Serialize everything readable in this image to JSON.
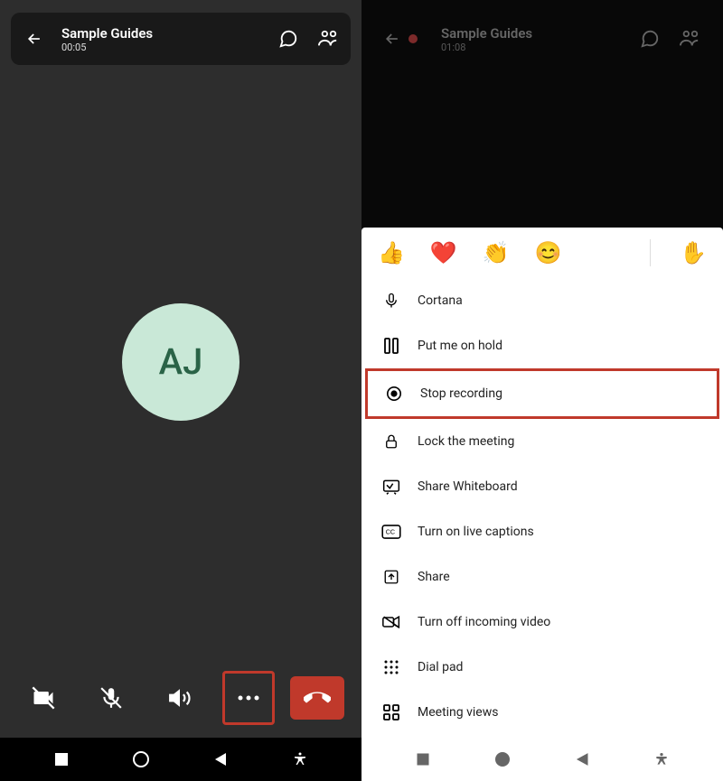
{
  "left": {
    "header": {
      "title": "Sample Guides",
      "duration": "00:05"
    },
    "avatar_initials": "AJ",
    "icons": {
      "back": "back-arrow",
      "chat": "chat-icon",
      "people": "people-icon",
      "camera_off": "camera-off-icon",
      "mic_off": "mic-off-icon",
      "speaker": "speaker-icon",
      "more": "more-icon",
      "hangup": "hangup-icon"
    }
  },
  "right": {
    "header": {
      "title": "Sample Guides",
      "duration": "01:08",
      "recording_dot": true
    },
    "reactions": [
      "👍",
      "❤️",
      "👏",
      "😊",
      "✋"
    ],
    "menu": [
      {
        "icon": "mic-icon",
        "label": "Cortana",
        "highlight": false
      },
      {
        "icon": "pause-icon",
        "label": "Put me on hold",
        "highlight": false
      },
      {
        "icon": "record-icon",
        "label": "Stop recording",
        "highlight": true
      },
      {
        "icon": "lock-icon",
        "label": "Lock the meeting",
        "highlight": false
      },
      {
        "icon": "whiteboard-icon",
        "label": "Share Whiteboard",
        "highlight": false
      },
      {
        "icon": "cc-icon",
        "label": "Turn on live captions",
        "highlight": false
      },
      {
        "icon": "share-icon",
        "label": "Share",
        "highlight": false
      },
      {
        "icon": "video-off-icon",
        "label": "Turn off incoming video",
        "highlight": false
      },
      {
        "icon": "dialpad-icon",
        "label": "Dial pad",
        "highlight": false
      },
      {
        "icon": "grid-icon",
        "label": "Meeting views",
        "highlight": false
      }
    ]
  },
  "sysnav": {
    "square": "recent-apps",
    "circle": "home",
    "triangle": "back",
    "a11y": "accessibility"
  }
}
